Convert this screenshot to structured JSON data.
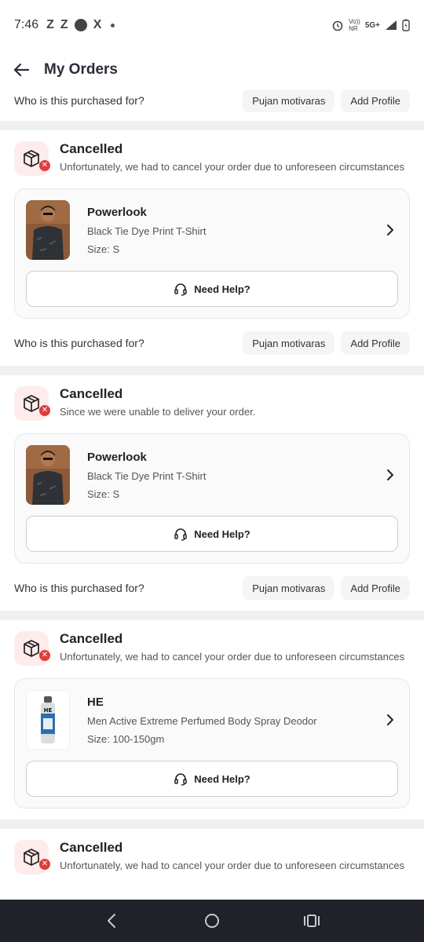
{
  "status_bar": {
    "time": "7:46",
    "left_glyphs": [
      "Z",
      "Z",
      "X"
    ],
    "network_top": "Vo))",
    "network_bottom": "NR",
    "network_type": "5G+"
  },
  "header": {
    "title": "My Orders"
  },
  "profile": {
    "question": "Who is this purchased for?",
    "chip_name": "Pujan motivaras",
    "chip_add": "Add Profile"
  },
  "orders": [
    {
      "status": "Cancelled",
      "description": "Unfortunately, we had to cancel your order due to unforeseen circumstances",
      "brand": "Powerlook",
      "product": "Black Tie Dye Print T-Shirt",
      "size": "Size: S",
      "help": "Need Help?"
    },
    {
      "status": "Cancelled",
      "description": "Since we were unable to deliver your order.",
      "brand": "Powerlook",
      "product": "Black Tie Dye Print T-Shirt",
      "size": "Size: S",
      "help": "Need Help?"
    },
    {
      "status": "Cancelled",
      "description": "Unfortunately, we had to cancel your order due to unforeseen circumstances",
      "brand": "HE",
      "product": "Men Active Extreme Perfumed Body Spray Deodor",
      "size": "Size: 100-150gm",
      "help": "Need Help?"
    },
    {
      "status": "Cancelled",
      "description": "Unfortunately, we had to cancel your order due to unforeseen circumstances"
    }
  ],
  "colors": {
    "accent_red": "#e23b3b",
    "status_icon_bg": "#fdeceb",
    "nav_bar": "#1f2229"
  },
  "icons": {
    "back": "arrow-left-icon",
    "status": "package-cancel-icon",
    "help": "headset-icon",
    "chevron": "chevron-right-icon"
  }
}
